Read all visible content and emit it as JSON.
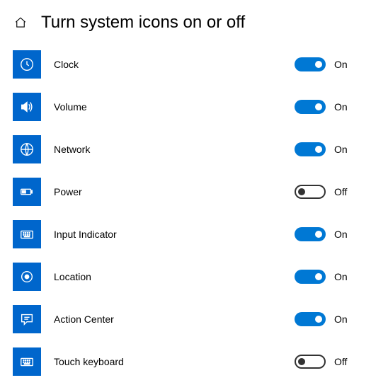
{
  "title": "Turn system icons on or off",
  "stateLabels": {
    "on": "On",
    "off": "Off"
  },
  "colors": {
    "accent": "#0066cc",
    "toggleOn": "#0078d4"
  },
  "items": [
    {
      "icon": "clock-icon",
      "label": "Clock",
      "on": true
    },
    {
      "icon": "volume-icon",
      "label": "Volume",
      "on": true
    },
    {
      "icon": "network-icon",
      "label": "Network",
      "on": true
    },
    {
      "icon": "power-icon",
      "label": "Power",
      "on": false
    },
    {
      "icon": "input-indicator-icon",
      "label": "Input Indicator",
      "on": true
    },
    {
      "icon": "location-icon",
      "label": "Location",
      "on": true
    },
    {
      "icon": "action-center-icon",
      "label": "Action Center",
      "on": true
    },
    {
      "icon": "touch-keyboard-icon",
      "label": "Touch keyboard",
      "on": false
    }
  ]
}
